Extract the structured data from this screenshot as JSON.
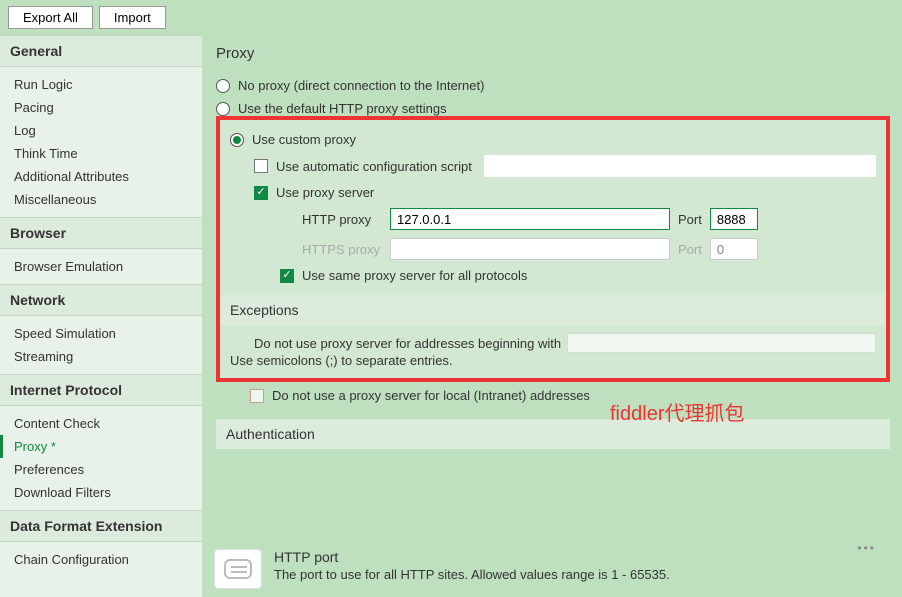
{
  "toolbar": {
    "export_all": "Export All",
    "import": "Import"
  },
  "sidebar": {
    "sections": [
      {
        "header": "General",
        "items": [
          "Run Logic",
          "Pacing",
          "Log",
          "Think Time",
          "Additional Attributes",
          "Miscellaneous"
        ]
      },
      {
        "header": "Browser",
        "items": [
          "Browser Emulation"
        ]
      },
      {
        "header": "Network",
        "items": [
          "Speed Simulation",
          "Streaming"
        ]
      },
      {
        "header": "Internet Protocol",
        "items": [
          "Content Check",
          "Proxy *",
          "Preferences",
          "Download Filters"
        ]
      },
      {
        "header": "Data Format Extension",
        "items": [
          "Chain Configuration"
        ]
      }
    ],
    "active": "Proxy *"
  },
  "page": {
    "title": "Proxy",
    "radio_no_proxy": "No proxy (direct connection to the Internet)",
    "radio_default": "Use the default HTTP proxy settings",
    "radio_custom": "Use custom proxy",
    "chk_auto_script": "Use automatic configuration script",
    "chk_proxy_server": "Use proxy server",
    "http_label": "HTTP proxy",
    "http_host": "127.0.0.1",
    "http_port_label": "Port",
    "http_port": "8888",
    "https_label": "HTTPS proxy",
    "https_host": "",
    "https_port_label": "Port",
    "https_port": "0",
    "chk_same_all": "Use same proxy server for all protocols",
    "exceptions_header": "Exceptions",
    "exc_line1": "Do not use proxy server for addresses beginning with",
    "exc_line2": "Use semicolons (;) to separate entries.",
    "chk_local": "Do not use a proxy server for local (Intranet) addresses",
    "auth_header": "Authentication",
    "overlay": "fiddler代理抓包"
  },
  "footer": {
    "title": "HTTP port",
    "desc": "The port to use for all HTTP sites. Allowed values range is 1 - 65535."
  }
}
